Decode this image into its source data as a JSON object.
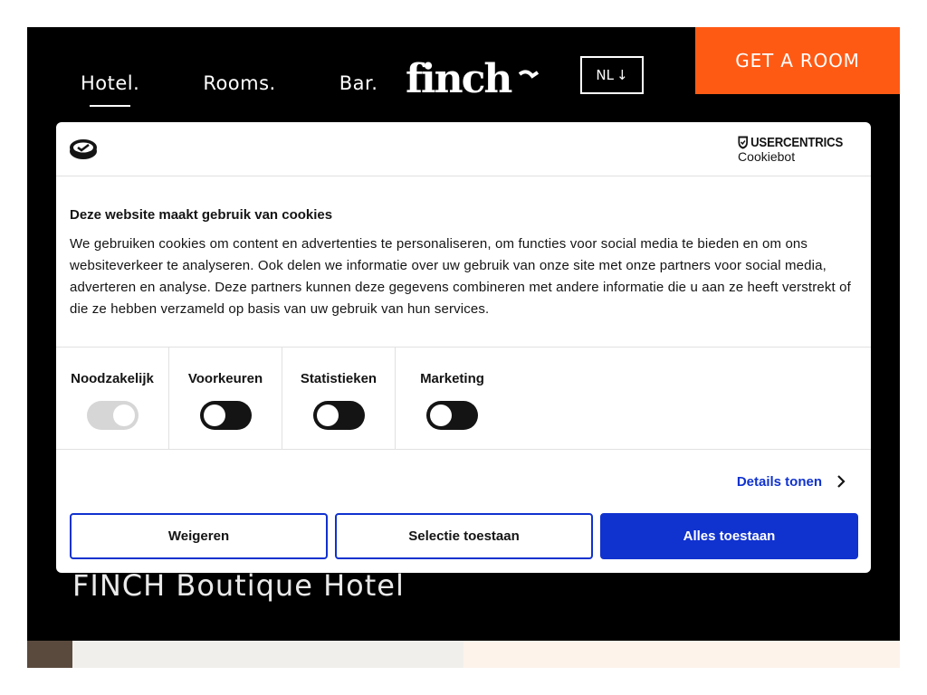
{
  "site": {
    "nav": [
      {
        "label": "Hotel."
      },
      {
        "label": "Rooms."
      },
      {
        "label": "Bar."
      }
    ],
    "logo_text": "finch",
    "lang": {
      "label": "NL",
      "arrow": "↓"
    },
    "cta_label": "GET A ROOM",
    "hero_title": "FINCH Boutique Hotel",
    "colors": {
      "cta": "#ff5a14",
      "background": "#000000"
    }
  },
  "cookie_dialog": {
    "brand": {
      "name": "USERCENTRICS",
      "product": "Cookiebot"
    },
    "title": "Deze website maakt gebruik van cookies",
    "text": "We gebruiken cookies om content en advertenties te personaliseren, om functies voor social media te bieden en om ons websiteverkeer te analyseren. Ook delen we informatie over uw gebruik van onze site met onze partners voor social media, adverteren en analyse. Deze partners kunnen deze gegevens combineren met andere informatie die u aan ze heeft verstrekt of die ze hebben verzameld op basis van uw gebruik van hun services.",
    "toggles": [
      {
        "label": "Noodzakelijk",
        "checked": true,
        "disabled": true
      },
      {
        "label": "Voorkeuren",
        "checked": false,
        "disabled": false
      },
      {
        "label": "Statistieken",
        "checked": false,
        "disabled": false
      },
      {
        "label": "Marketing",
        "checked": false,
        "disabled": false
      }
    ],
    "details_label": "Details tonen",
    "buttons": {
      "decline": "Weigeren",
      "selection": "Selectie toestaan",
      "allow_all": "Alles toestaan"
    },
    "colors": {
      "accent": "#1032cf"
    }
  }
}
